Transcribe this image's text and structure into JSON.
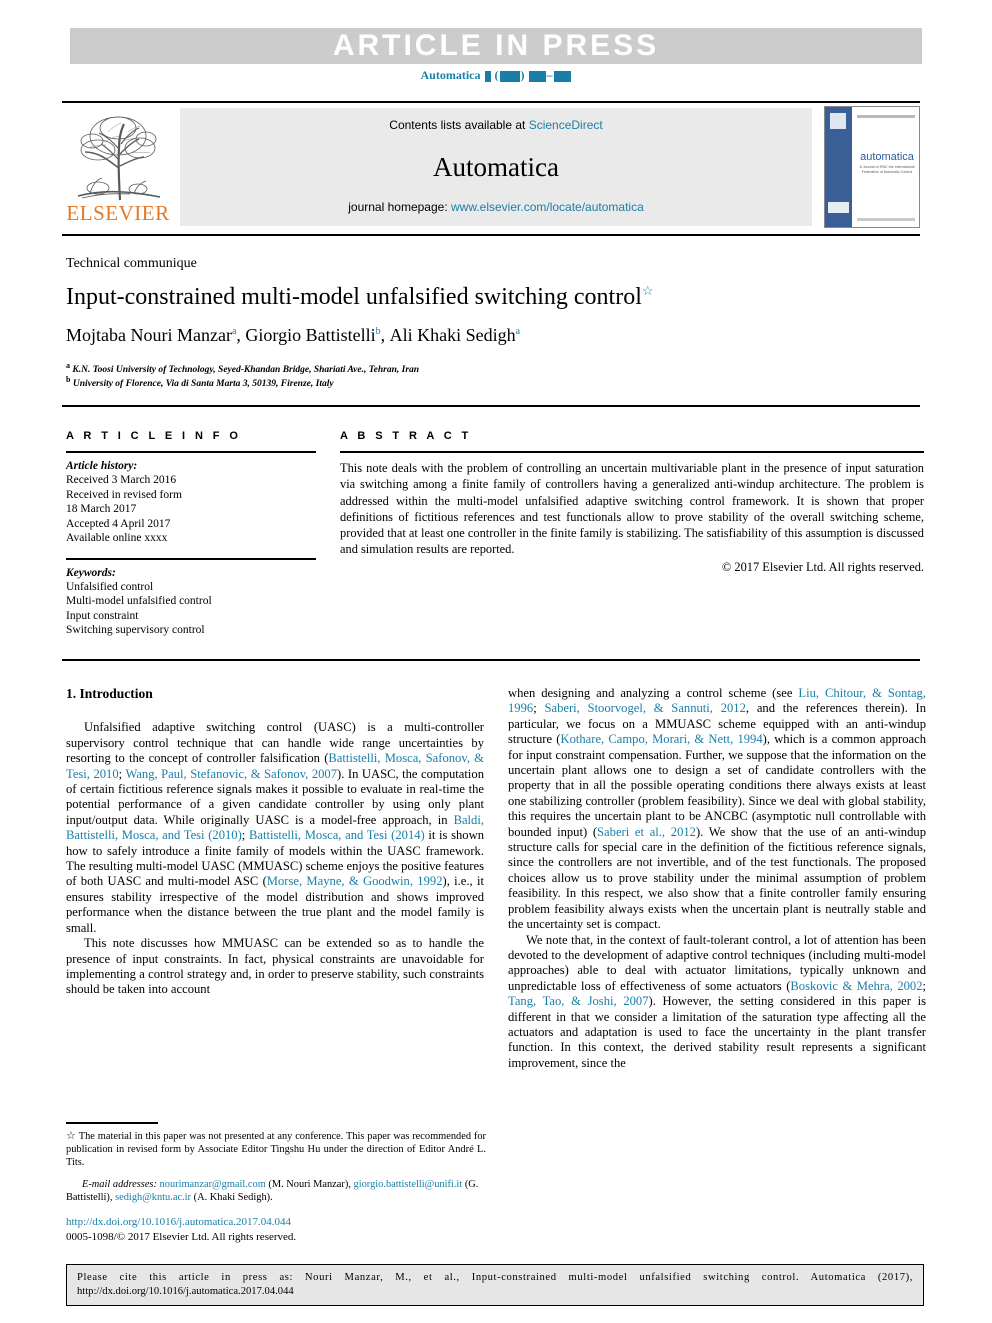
{
  "banner": {
    "text": "ARTICLE  IN  PRESS",
    "journal_ref_prefix": "Automatica",
    "journal_ref_note": "volume/issue/page placeholders shown as filled blocks",
    "gray": "#cccccc"
  },
  "masthead": {
    "publisher": "ELSEVIER",
    "contents_prefix": "Contents lists available at ",
    "contents_link": "ScienceDirect",
    "journal_title": "Automatica",
    "homepage_prefix": "journal homepage: ",
    "homepage_link": "www.elsevier.com/locate/automatica",
    "cover_title": "automatica",
    "cover_subtitle": "A Journal of IFAC the International Federation of Automatic Control"
  },
  "article": {
    "kind": "Technical communique",
    "title": "Input-constrained multi-model unfalsified switching control",
    "title_star": "☆",
    "authors": [
      {
        "name": "Mojtaba Nouri Manzar",
        "mark": "a"
      },
      {
        "name": "Giorgio Battistelli",
        "mark": "b"
      },
      {
        "name": "Ali Khaki Sedigh",
        "mark": "a"
      }
    ],
    "authors_line": "Mojtaba Nouri Manzar a, Giorgio Battistelli b, Ali Khaki Sedigh a",
    "affiliations": [
      {
        "mark": "a",
        "text": "K.N. Toosi University of Technology, Seyed-Khandan Bridge, Shariati Ave., Tehran, Iran"
      },
      {
        "mark": "b",
        "text": "University of Florence, Via di Santa Marta 3, 50139, Firenze, Italy"
      }
    ]
  },
  "info": {
    "heading": "A R T I C L E   I N F O",
    "history_label": "Article history:",
    "history": [
      "Received 3 March 2016",
      "Received in revised form",
      "18 March 2017",
      "Accepted 4 April 2017",
      "Available online xxxx"
    ],
    "keywords_label": "Keywords:",
    "keywords": [
      "Unfalsified control",
      "Multi-model unfalsified control",
      "Input constraint",
      "Switching supervisory control"
    ]
  },
  "abstract": {
    "heading": "A B S T R A C T",
    "body": "This note deals with the problem of controlling an uncertain multivariable plant in the presence of input saturation via switching among a finite family of controllers having a generalized anti-windup architecture. The problem is addressed within the multi-model unfalsified adaptive switching control framework. It is shown that proper definitions of fictitious references and test functionals allow to prove stability of the overall switching scheme, provided that at least one controller in the finite family is stabilizing. The satisfiability of this assumption is discussed and simulation results are reported.",
    "copyright": "© 2017 Elsevier Ltd. All rights reserved."
  },
  "body": {
    "section_heading": "1. Introduction",
    "left_paragraphs": [
      {
        "runs": [
          {
            "t": "Unfalsified adaptive switching control (UASC) is a multi-controller supervisory control technique that can handle wide range uncertainties by resorting to the concept of controller falsification ("
          },
          {
            "t": "Battistelli, Mosca, Safonov, & Tesi, 2010",
            "ref": true
          },
          {
            "t": "; "
          },
          {
            "t": "Wang, Paul, Stefanovic, & Safonov, 2007",
            "ref": true
          },
          {
            "t": "). In UASC, the computation of certain fictitious reference signals makes it possible to evaluate in real-time the potential performance of a given candidate controller by using only plant input/output data. While originally UASC is a model-free approach, in "
          },
          {
            "t": "Baldi, Battistelli, Mosca, and Tesi (2010)",
            "ref": true
          },
          {
            "t": "; "
          },
          {
            "t": "Battistelli, Mosca, and Tesi (2014)",
            "ref": true
          },
          {
            "t": " it is shown how to safely introduce a finite family of models within the UASC framework. The resulting multi-model UASC (MMUASC) scheme enjoys the positive features of both UASC and multi-model ASC ("
          },
          {
            "t": "Morse, Mayne, & Goodwin, 1992",
            "ref": true
          },
          {
            "t": "), i.e., it ensures stability irrespective of the model distribution and shows improved performance when the distance between the true plant and the model family is small."
          }
        ]
      },
      {
        "runs": [
          {
            "t": "This note discusses how MMUASC can be extended so as to handle the presence of input constraints. In fact, physical constraints are unavoidable for implementing a control strategy and, in order to preserve stability, such constraints should be taken into account"
          }
        ]
      }
    ],
    "right_paragraphs": [
      {
        "runs": [
          {
            "t": "when designing and analyzing a control scheme (see "
          },
          {
            "t": "Liu, Chitour, & Sontag, 1996",
            "ref": true
          },
          {
            "t": "; "
          },
          {
            "t": "Saberi, Stoorvogel, & Sannuti, 2012",
            "ref": true
          },
          {
            "t": ", and the references therein). In particular, we focus on a MMUASC scheme equipped with an anti-windup structure ("
          },
          {
            "t": "Kothare, Campo, Morari, & Nett, 1994",
            "ref": true
          },
          {
            "t": "), which is a common approach for input constraint compensation. Further, we suppose that the information on the uncertain plant allows one to design a set of candidate controllers with the property that in all the possible operating conditions there always exists at least one stabilizing controller (problem feasibility). Since we deal with global stability, this requires the uncertain plant to be ANCBC (asymptotic null controllable with bounded input) ("
          },
          {
            "t": "Saberi et al., 2012",
            "ref": true
          },
          {
            "t": "). We show that the use of an anti-windup structure calls for special care in the definition of the fictitious reference signals, since the controllers are not invertible, and of the test functionals. The proposed choices allow us to prove stability under the minimal assumption of problem feasibility. In this respect, we also show that a finite controller family ensuring problem feasibility always exists when the uncertain plant is neutrally stable and the uncertainty set is compact."
          }
        ],
        "no_indent": false
      },
      {
        "runs": [
          {
            "t": "We note that, in the context of fault-tolerant control, a lot of attention has been devoted to the development of adaptive control techniques (including multi-model approaches) able to deal with actuator limitations, typically unknown and unpredictable loss of effectiveness of some actuators ("
          },
          {
            "t": "Boskovic & Mehra, 2002",
            "ref": true
          },
          {
            "t": "; "
          },
          {
            "t": "Tang, Tao, & Joshi, 2007",
            "ref": true
          },
          {
            "t": "). However, the setting considered in this paper is different in that we consider a limitation of the saturation type affecting all the actuators and adaptation is used to face the uncertainty in the plant transfer function. In this context, the derived stability result represents a significant improvement, since the"
          }
        ]
      }
    ]
  },
  "footnote": {
    "star": "☆",
    "text": "The material in this paper was not presented at any conference. This paper was recommended for publication in revised form by Associate Editor Tingshu Hu under the direction of Editor André L. Tits.",
    "emails_label": "E-mail addresses:",
    "emails": [
      {
        "address": "nourimanzar@gmail.com",
        "owner": "(M. Nouri Manzar)"
      },
      {
        "address": "giorgio.battistelli@unifi.it",
        "owner": "(G. Battistelli)"
      },
      {
        "address": "sedigh@kntu.ac.ir",
        "owner": "(A. Khaki Sedigh)"
      }
    ],
    "doi": "http://dx.doi.org/10.1016/j.automatica.2017.04.044",
    "issn": "0005-1098/© 2017 Elsevier Ltd. All rights reserved."
  },
  "citation_box": {
    "line1": "Please cite this article in press as: Nouri Manzar, M., et al., Input-constrained multi-model unfalsified switching control. Automatica (2017),",
    "line2": "http://dx.doi.org/10.1016/j.automatica.2017.04.044"
  },
  "colors": {
    "link": "#1a7fa8",
    "elsevier_orange": "#e87722",
    "banner_gray": "#cccccc",
    "masthead_gray": "#eaeaea",
    "cite_gray": "#e6e6e6"
  }
}
